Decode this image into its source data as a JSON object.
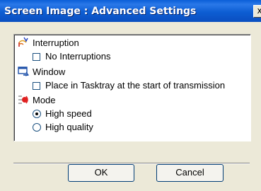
{
  "window": {
    "title": "Screen Image : Advanced Settings",
    "close_glyph": "x"
  },
  "sections": {
    "interruption": {
      "label": "Interruption",
      "icon": "interruption-icon",
      "option": "No Interruptions",
      "option_checked": false
    },
    "window": {
      "label": "Window",
      "icon": "window-icon",
      "option": "Place in Tasktray at the start of transmission",
      "option_checked": false
    },
    "mode": {
      "label": "Mode",
      "icon": "mode-icon",
      "options": [
        "High speed",
        "High quality"
      ],
      "selected": "High speed"
    }
  },
  "buttons": {
    "ok": "OK",
    "cancel": "Cancel"
  },
  "colors": {
    "titlebar": "#0a5fd8",
    "dialog_bg": "#ece9d8",
    "panel_bg": "#ffffff"
  }
}
